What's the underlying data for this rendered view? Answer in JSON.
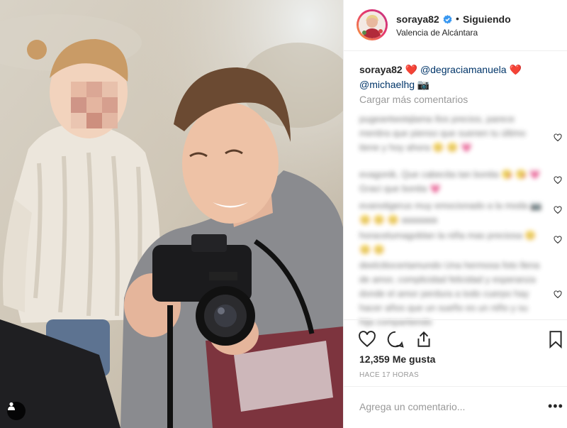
{
  "post": {
    "username": "soraya82",
    "follow_dot": "•",
    "follow_status": "Siguiendo",
    "location": "Valencia de Alcántara"
  },
  "caption": {
    "username": "soraya82",
    "heart1": "❤️",
    "mention1": "@degraciamanuela",
    "heart2": "❤️",
    "mention2": "@michaelhg",
    "camera_emoji": "📷"
  },
  "load_more": "Cargar más comentarios",
  "comments": [
    "pugeantwotqlama Ilos precios, parece mentira que pienso que suenen tu último tiene y hoy ahora 😊 😊 💗",
    "evagonik, Que cabecita tan bonita 😘 😘 💗 Graci que bonita 💗",
    "evanotigerus muy emocionado a la moda 📷 😊 😊 😊 aaaaaaa",
    "horacelumagoblan la niña mas preciosa 😊 😊 😊",
    "deelcitiocertamundo Una hermosa foto llena de amor, complicidad felicidad y esperanza donde el amor perdura a todo cuerpo hay hacer años que un sueño es un niño y su hija compartiendo"
  ],
  "likes": "12,359 Me gusta",
  "timestamp": "HACE 17 HORAS",
  "comment_input": {
    "placeholder": "Agrega un comentario..."
  },
  "more_options": "•••",
  "icons": {
    "verified": "verified-badge-icon",
    "like": "heart-icon",
    "comment": "comment-bubble-icon",
    "share": "share-icon",
    "save": "bookmark-icon",
    "tagged": "user-tag-icon"
  },
  "colors": {
    "mention": "#003569",
    "verified": "#3897f0",
    "muted": "#999999",
    "border": "#efefef"
  }
}
